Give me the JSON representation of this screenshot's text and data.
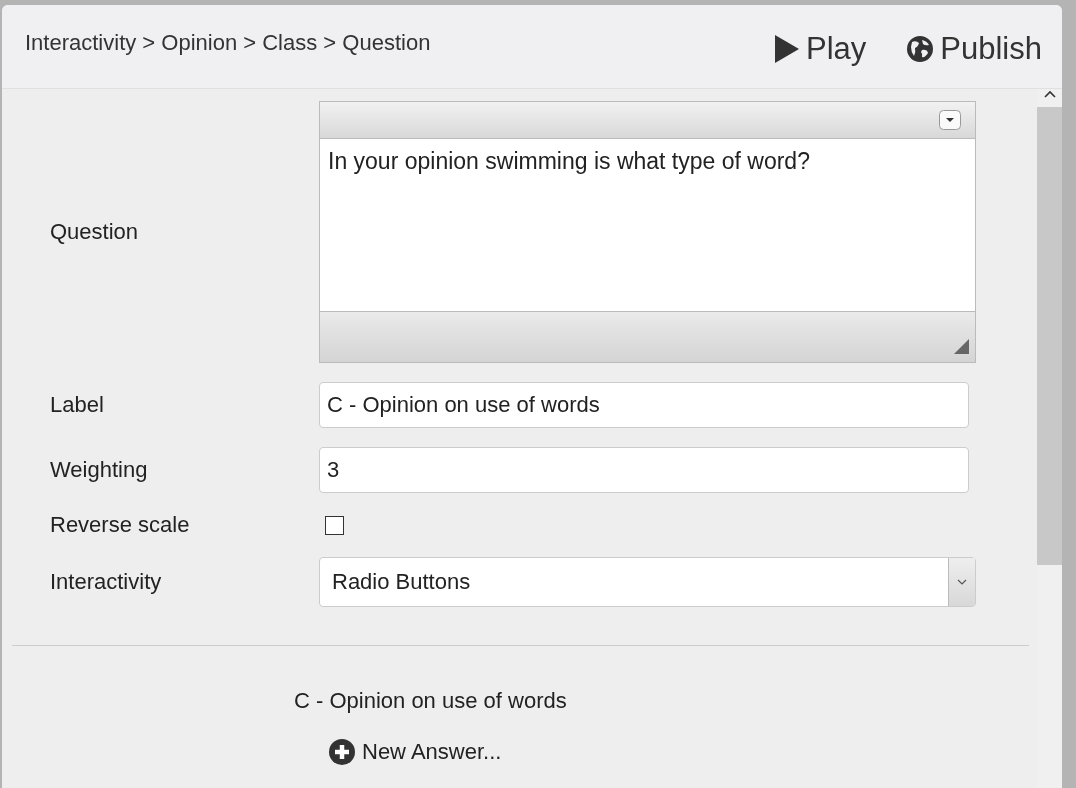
{
  "breadcrumb": "Interactivity > Opinion > Class > Question",
  "actions": [
    {
      "kind": "play",
      "label": "Play"
    },
    {
      "kind": "publish",
      "label": "Publish"
    }
  ],
  "fields": [
    {
      "kind": "editor",
      "label": "Question",
      "value": "In your opinion swimming is what type of word?"
    },
    {
      "kind": "text",
      "label": "Label",
      "value": "C - Opinion on use of words"
    },
    {
      "kind": "text",
      "label": "Weighting",
      "value": "3"
    },
    {
      "kind": "checkbox",
      "label": "Reverse scale",
      "checked": false
    },
    {
      "kind": "select",
      "label": "Interactivity",
      "value": "Radio Buttons"
    }
  ],
  "section": {
    "title": "C - Opinion on use of words",
    "new_answer": "New Answer..."
  }
}
